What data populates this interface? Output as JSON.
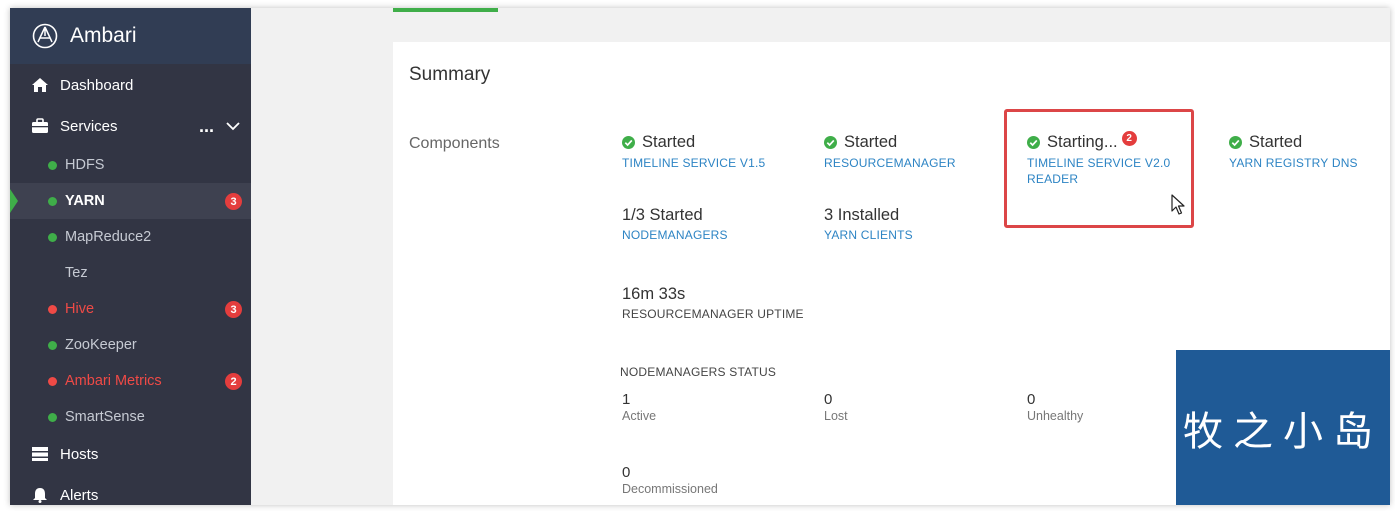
{
  "app": {
    "title": "Ambari"
  },
  "sidebar": {
    "dashboard_label": "Dashboard",
    "services_label": "Services",
    "services_more": "...",
    "services": [
      {
        "label": "HDFS",
        "status": "green"
      },
      {
        "label": "YARN",
        "status": "green",
        "badge": "3",
        "active": true
      },
      {
        "label": "MapReduce2",
        "status": "green"
      },
      {
        "label": "Tez",
        "status": "none"
      },
      {
        "label": "Hive",
        "status": "red",
        "badge": "3"
      },
      {
        "label": "ZooKeeper",
        "status": "green"
      },
      {
        "label": "Ambari Metrics",
        "status": "red",
        "badge": "2"
      },
      {
        "label": "SmartSense",
        "status": "green"
      }
    ],
    "hosts_label": "Hosts",
    "alerts_label": "Alerts"
  },
  "summary": {
    "title": "Summary",
    "components_label": "Components",
    "components": [
      {
        "status": "Started",
        "name": "TIMELINE SERVICE V1.5"
      },
      {
        "status": "Started",
        "name": "RESOURCEMANAGER"
      },
      {
        "status": "Starting...",
        "name": "TIMELINE SERVICE V2.0 READER",
        "badge": "2"
      },
      {
        "status": "Started",
        "name": "YARN REGISTRY DNS"
      }
    ],
    "nodemanagers": {
      "value": "1/3 Started",
      "caption": "NODEMANAGERS"
    },
    "yarn_clients": {
      "value": "3 Installed",
      "caption": "YARN CLIENTS"
    },
    "uptime": {
      "value": "16m 33s",
      "caption": "RESOURCEMANAGER UPTIME"
    },
    "nm_status": {
      "title": "NODEMANAGERS STATUS",
      "active": {
        "value": "1",
        "caption": "Active"
      },
      "lost": {
        "value": "0",
        "caption": "Lost"
      },
      "unhealthy": {
        "value": "0",
        "caption": "Unhealthy"
      },
      "decommissioned": {
        "value": "0",
        "caption": "Decommissioned"
      }
    }
  },
  "watermark": {
    "text": "牧之小岛"
  },
  "colors": {
    "sidebar_bg": "#323544",
    "brand_bg": "#313d54",
    "status_green": "#3fae49",
    "status_red": "#ef4a46",
    "link_blue": "#2d84c4",
    "highlight_red": "#dc4647",
    "watermark_bg": "#1f5a96"
  }
}
